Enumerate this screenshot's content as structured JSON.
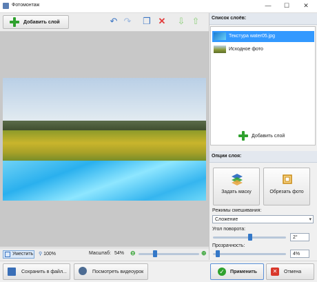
{
  "window": {
    "title": "Фотомонтаж",
    "min": "—",
    "max": "☐",
    "close": "✕"
  },
  "toolbar": {
    "add_layer": "Добавить слой"
  },
  "layers_panel": {
    "title": "Список слоёв:",
    "layers": [
      {
        "label": "Текстура water05.jpg",
        "selected": true
      },
      {
        "label": "Исходное фото",
        "selected": false
      }
    ],
    "add_layer": "Добавить слой"
  },
  "options": {
    "title": "Опции слоя:",
    "mask_button": "Задать маску",
    "crop_button": "Обрезать фото",
    "blend_label": "Режимы смешивания:",
    "blend_value": "Сложение",
    "rotation_label": "Угол поворота:",
    "rotation_value": "2°",
    "opacity_label": "Прозрачность:",
    "opacity_value": "4%",
    "rotation_fraction": 0.51,
    "opacity_fraction": 0.04
  },
  "status": {
    "fit": "Уместить",
    "zoom100": "100%",
    "scale_label": "Масштаб:",
    "scale_value": "54%",
    "zoom_fraction": 0.26
  },
  "bottom": {
    "save": "Сохранить в файл...",
    "video": "Посмотреть видеоурок",
    "apply": "Применить",
    "cancel": "Отмена"
  },
  "colors": {
    "accent": "#3399ff",
    "add": "#2fa12e",
    "delete": "#e23b3b",
    "apply": "#2fa12e",
    "cancel": "#d9382b"
  }
}
